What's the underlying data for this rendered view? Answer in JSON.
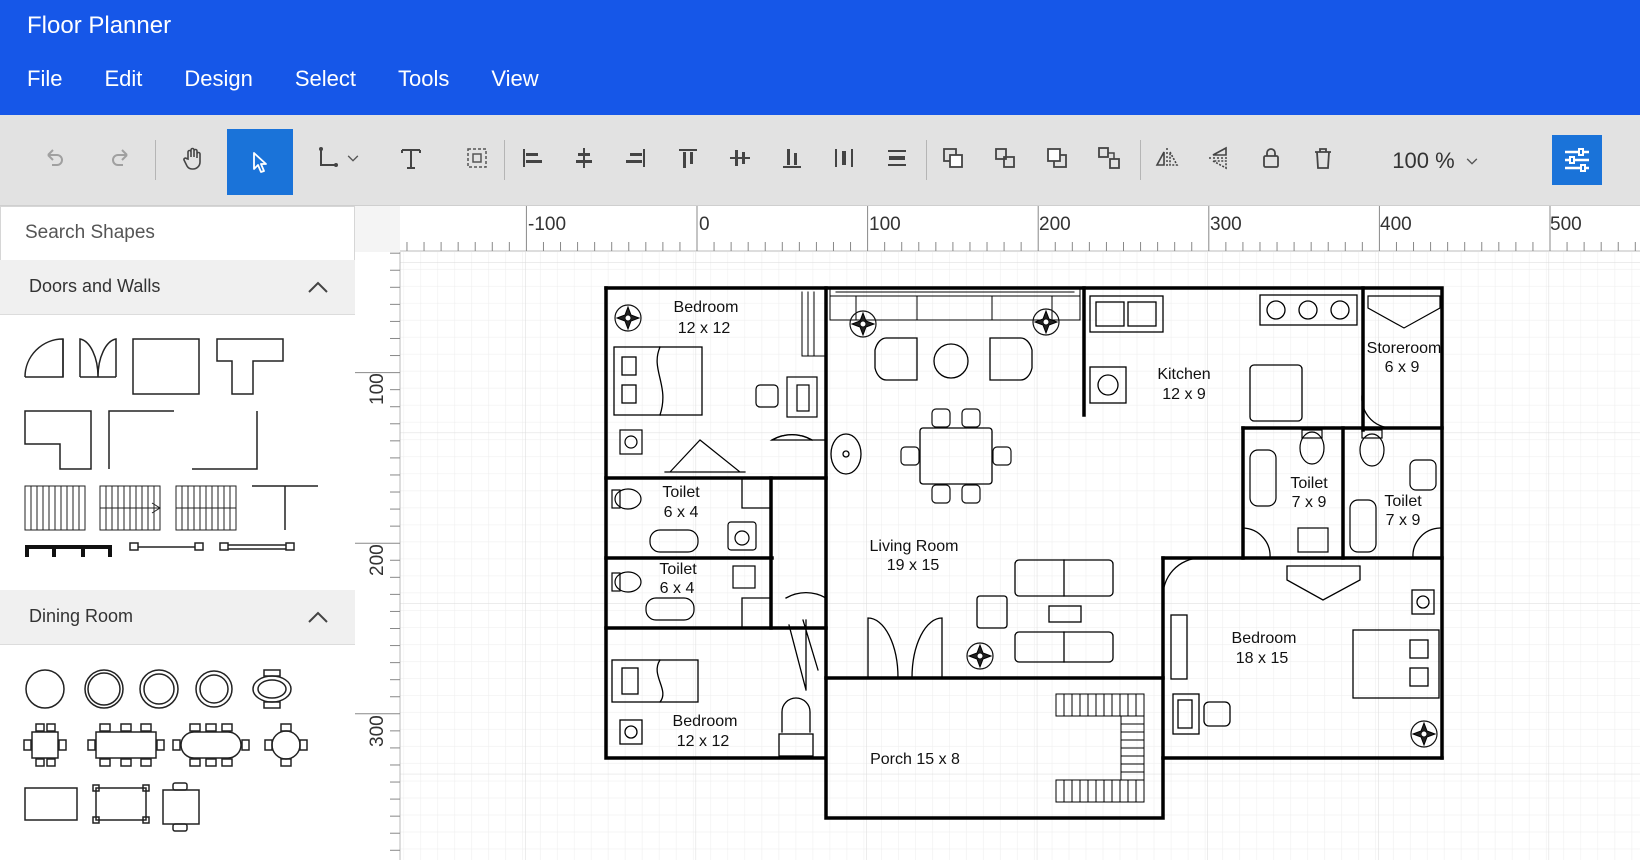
{
  "app": {
    "title": "Floor Planner"
  },
  "menu": [
    "File",
    "Edit",
    "Design",
    "Select",
    "Tools",
    "View"
  ],
  "toolbar": {
    "zoom": "100 %",
    "buttons": [
      "undo-icon",
      "redo-icon",
      "pan-icon",
      "pointer-icon",
      "connector-icon",
      "text-icon",
      "group-icon",
      "align-left-icon",
      "align-center-icon",
      "align-right-icon",
      "align-top-icon",
      "align-middle-icon",
      "align-bottom-icon",
      "distribute-horizontal-icon",
      "distribute-vertical-icon",
      "bring-forward-icon",
      "send-backward-icon",
      "bring-front-icon",
      "send-back-icon",
      "flip-horizontal-icon",
      "flip-vertical-icon",
      "lock-icon",
      "delete-icon",
      "properties-icon"
    ],
    "active_tool": "pointer-icon",
    "accent": "#1a73d9"
  },
  "sidebar": {
    "search_placeholder": "Search Shapes",
    "sections": [
      {
        "title": "Doors and Walls"
      },
      {
        "title": "Dining Room"
      }
    ]
  },
  "rulers": {
    "horizontal": [
      "-100",
      "0",
      "100",
      "200",
      "300",
      "400",
      "500"
    ],
    "vertical": [
      "100",
      "200",
      "300"
    ]
  },
  "plan": {
    "rooms": [
      {
        "name": "Bedroom",
        "size": "12 x 12"
      },
      {
        "name": "Kitchen",
        "size": "12 x 9"
      },
      {
        "name": "Storeroom",
        "size": "6 x 9"
      },
      {
        "name": "Toilet",
        "size": "6 x 4"
      },
      {
        "name": "Toilet",
        "size": "6 x 4"
      },
      {
        "name": "Toilet",
        "size": "7 x 9"
      },
      {
        "name": "Toilet",
        "size": "7 x 9"
      },
      {
        "name": "Living Room",
        "size": "19 x 15"
      },
      {
        "name": "Bedroom",
        "size": "18 x 15"
      },
      {
        "name": "Bedroom",
        "size": "12 x 12"
      },
      {
        "name": "Porch 15 x 8",
        "size": ""
      }
    ]
  },
  "colors": {
    "header": "#1657E8",
    "toolbar_bg": "#e2e2e2",
    "accent": "#1a73d9"
  }
}
